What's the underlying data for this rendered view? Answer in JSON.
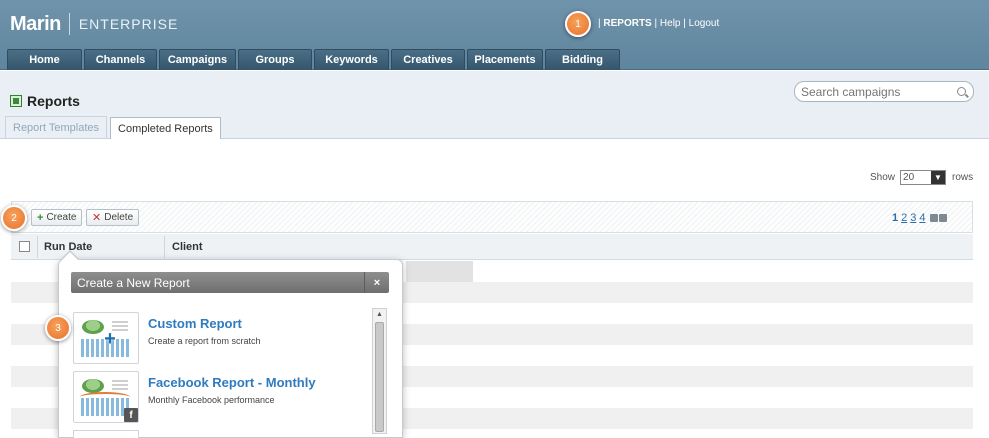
{
  "app": {
    "logo": "Marin",
    "edition": "ENTERPRISE"
  },
  "toplinks": {
    "sep1": "|",
    "reports": "REPORTS",
    "sep2": "|",
    "help": "Help",
    "sep3": "|",
    "logout": "Logout"
  },
  "nav": {
    "tabs": [
      {
        "label": "Home"
      },
      {
        "label": "Channels"
      },
      {
        "label": "Campaigns"
      },
      {
        "label": "Groups"
      },
      {
        "label": "Keywords"
      },
      {
        "label": "Creatives"
      },
      {
        "label": "Placements"
      },
      {
        "label": "Bidding"
      }
    ]
  },
  "page": {
    "title": "Reports",
    "search_placeholder": "Search campaigns",
    "subtabs": [
      {
        "label": "Report Templates",
        "active": false
      },
      {
        "label": "Completed Reports",
        "active": true
      }
    ]
  },
  "rows_control": {
    "show_label": "Show",
    "value": "20",
    "rows_label": "rows"
  },
  "toolbar": {
    "create_label": "Create",
    "delete_label": "Delete"
  },
  "pager": {
    "pages": [
      "1",
      "2",
      "3",
      "4"
    ],
    "current": "1"
  },
  "table": {
    "columns": [
      "Run Date",
      "Client"
    ]
  },
  "popup": {
    "title": "Create a New Report",
    "close": "×",
    "items": [
      {
        "title": "Custom Report",
        "description": "Create a report from scratch"
      },
      {
        "title": "Facebook Report - Monthly",
        "description": "Monthly Facebook performance",
        "badge": "f"
      }
    ]
  },
  "markers": [
    "1",
    "2",
    "3"
  ],
  "colors": {
    "header": "#6189a2",
    "nav_tab": "#3d6076",
    "marker": "#ec7b35",
    "link": "#2f7bbf"
  }
}
